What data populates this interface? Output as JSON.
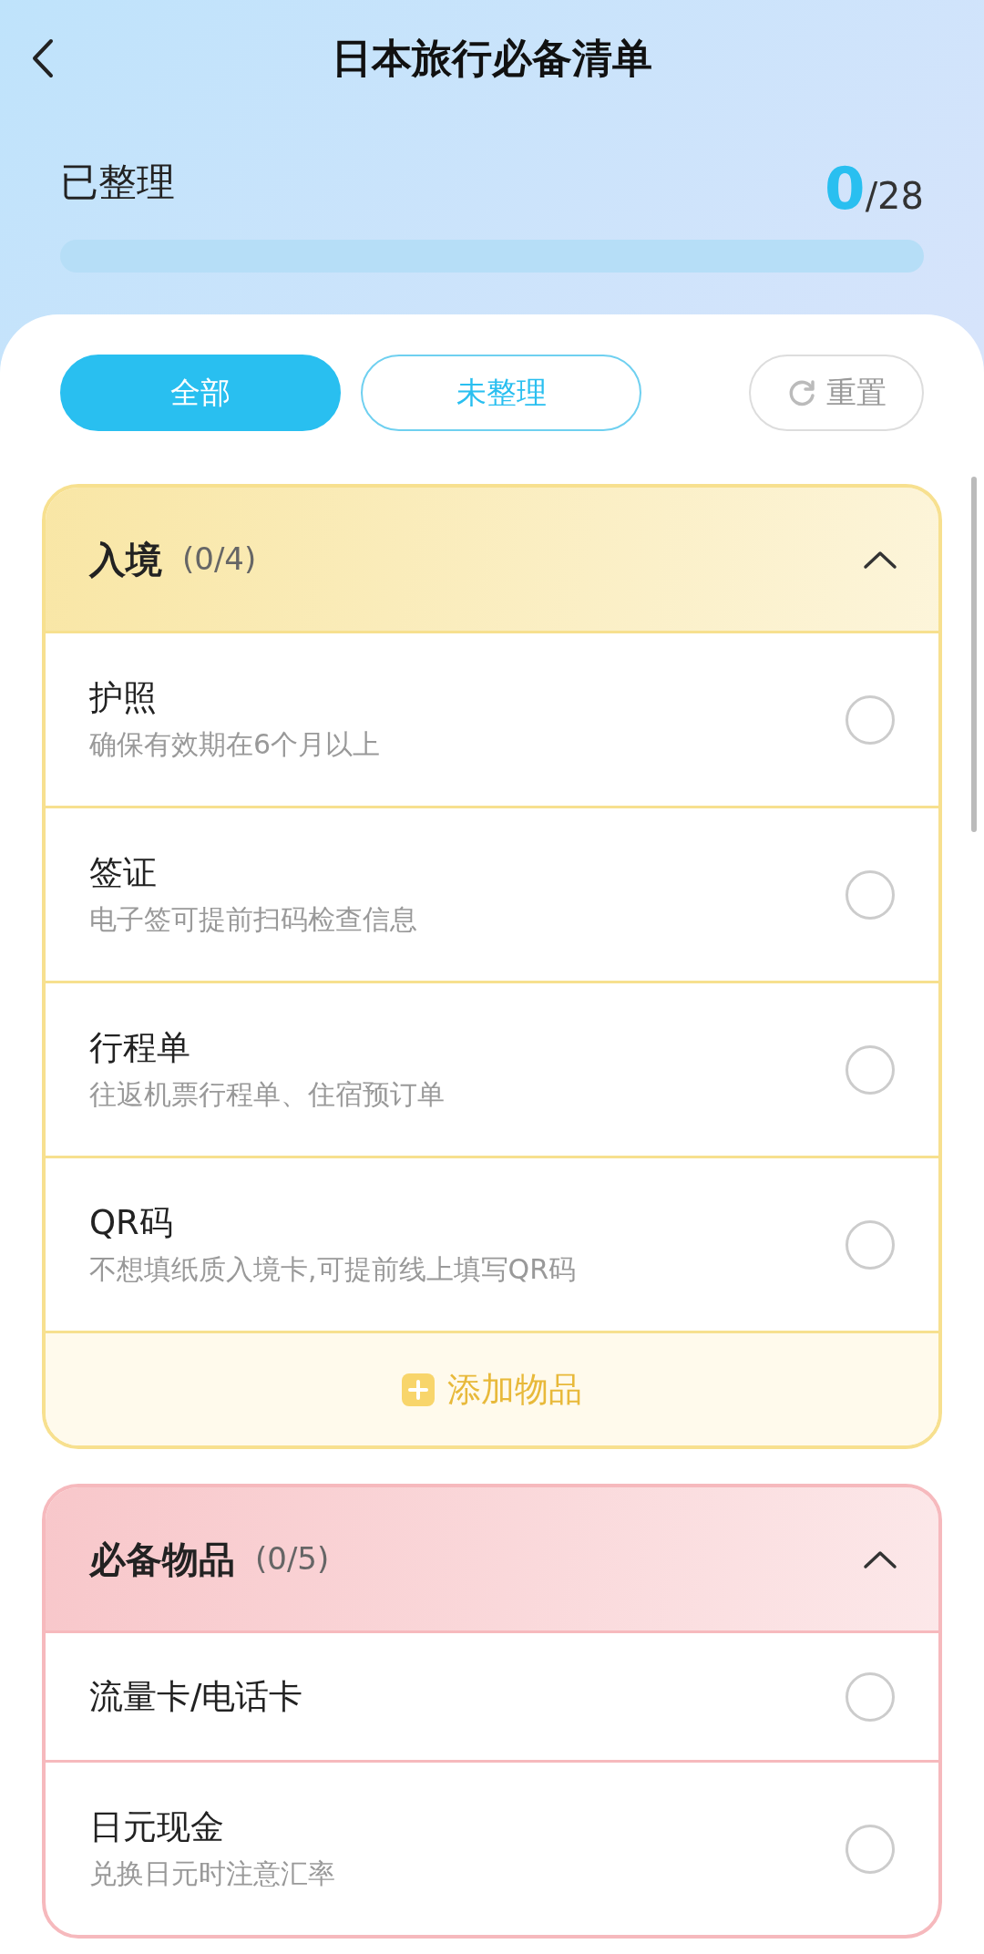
{
  "header": {
    "title": "日本旅行必备清单"
  },
  "progress": {
    "label": "已整理",
    "done": "0",
    "total": "/28",
    "level": 0
  },
  "filters": [
    {
      "label": "全部",
      "selected": true
    },
    {
      "label": "未整理",
      "selected": false
    }
  ],
  "reset_button": {
    "label": "重置"
  },
  "sections": [
    {
      "title": "入境",
      "count": "(0/4)",
      "expanded": true,
      "color": "#f7e08f",
      "items": [
        {
          "name": "护照",
          "note": "确保有效期在6个月以上",
          "checked": false
        },
        {
          "name": "签证",
          "note": "电子签可提前扫码检查信息",
          "checked": false
        },
        {
          "name": "行程单",
          "note": "往返机票行程单、住宿预订单",
          "checked": false
        },
        {
          "name": "QR码",
          "note": "不想填纸质入境卡,可提前线上填写QR码",
          "checked": false
        }
      ],
      "add_button": "添加物品"
    },
    {
      "title": "必备物品",
      "count": "(0/5)",
      "expanded": true,
      "color": "#f6b9bd",
      "items": [
        {
          "name": "流量卡/电话卡",
          "checked": false
        },
        {
          "name": "日元现金",
          "note": "兑换日元时注意汇率",
          "checked": false
        }
      ]
    }
  ]
}
